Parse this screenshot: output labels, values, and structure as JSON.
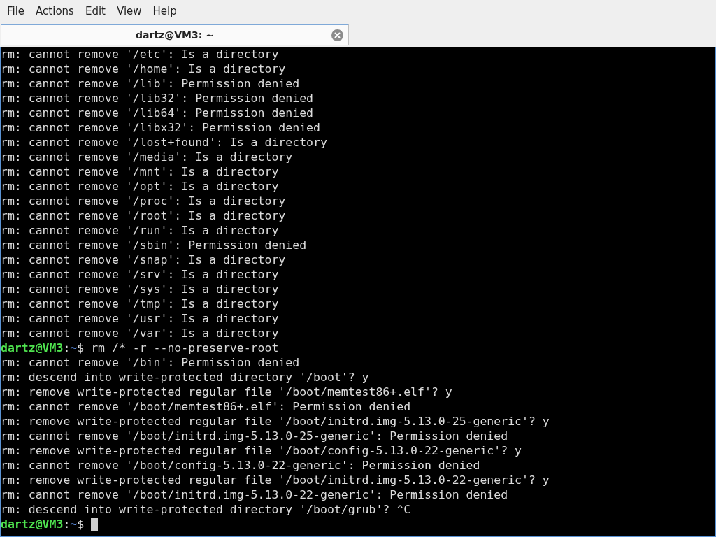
{
  "menu": [
    "File",
    "Actions",
    "Edit",
    "View",
    "Help"
  ],
  "tabs": [
    {
      "title": "dartz@VM3: ~",
      "selected": true
    }
  ],
  "terminal": {
    "lines": [
      {
        "kind": "output",
        "text": "rm: cannot remove '/etc': Is a directory"
      },
      {
        "kind": "output",
        "text": "rm: cannot remove '/home': Is a directory"
      },
      {
        "kind": "output",
        "text": "rm: cannot remove '/lib': Permission denied"
      },
      {
        "kind": "output",
        "text": "rm: cannot remove '/lib32': Permission denied"
      },
      {
        "kind": "output",
        "text": "rm: cannot remove '/lib64': Permission denied"
      },
      {
        "kind": "output",
        "text": "rm: cannot remove '/libx32': Permission denied"
      },
      {
        "kind": "output",
        "text": "rm: cannot remove '/lost+found': Is a directory"
      },
      {
        "kind": "output",
        "text": "rm: cannot remove '/media': Is a directory"
      },
      {
        "kind": "output",
        "text": "rm: cannot remove '/mnt': Is a directory"
      },
      {
        "kind": "output",
        "text": "rm: cannot remove '/opt': Is a directory"
      },
      {
        "kind": "output",
        "text": "rm: cannot remove '/proc': Is a directory"
      },
      {
        "kind": "output",
        "text": "rm: cannot remove '/root': Is a directory"
      },
      {
        "kind": "output",
        "text": "rm: cannot remove '/run': Is a directory"
      },
      {
        "kind": "output",
        "text": "rm: cannot remove '/sbin': Permission denied"
      },
      {
        "kind": "output",
        "text": "rm: cannot remove '/snap': Is a directory"
      },
      {
        "kind": "output",
        "text": "rm: cannot remove '/srv': Is a directory"
      },
      {
        "kind": "output",
        "text": "rm: cannot remove '/sys': Is a directory"
      },
      {
        "kind": "output",
        "text": "rm: cannot remove '/tmp': Is a directory"
      },
      {
        "kind": "output",
        "text": "rm: cannot remove '/usr': Is a directory"
      },
      {
        "kind": "output",
        "text": "rm: cannot remove '/var': Is a directory"
      },
      {
        "kind": "prompt",
        "user_host": "dartz@VM3",
        "separator": ":",
        "path": "~",
        "symbol": "$",
        "command": "rm /* -r --no-preserve-root",
        "cursor": false
      },
      {
        "kind": "output",
        "text": "rm: cannot remove '/bin': Permission denied"
      },
      {
        "kind": "output",
        "text": "rm: descend into write-protected directory '/boot'? y"
      },
      {
        "kind": "output",
        "text": "rm: remove write-protected regular file '/boot/memtest86+.elf'? y"
      },
      {
        "kind": "output",
        "text": "rm: cannot remove '/boot/memtest86+.elf': Permission denied"
      },
      {
        "kind": "output",
        "text": "rm: remove write-protected regular file '/boot/initrd.img-5.13.0-25-generic'? y"
      },
      {
        "kind": "output",
        "text": "rm: cannot remove '/boot/initrd.img-5.13.0-25-generic': Permission denied"
      },
      {
        "kind": "output",
        "text": "rm: remove write-protected regular file '/boot/config-5.13.0-22-generic'? y"
      },
      {
        "kind": "output",
        "text": "rm: cannot remove '/boot/config-5.13.0-22-generic': Permission denied"
      },
      {
        "kind": "output",
        "text": "rm: remove write-protected regular file '/boot/initrd.img-5.13.0-22-generic'? y"
      },
      {
        "kind": "output",
        "text": "rm: cannot remove '/boot/initrd.img-5.13.0-22-generic': Permission denied"
      },
      {
        "kind": "output",
        "text": "rm: descend into write-protected directory '/boot/grub'? ^C"
      },
      {
        "kind": "prompt",
        "user_host": "dartz@VM3",
        "separator": ":",
        "path": "~",
        "symbol": "$",
        "cursor": true
      }
    ]
  }
}
